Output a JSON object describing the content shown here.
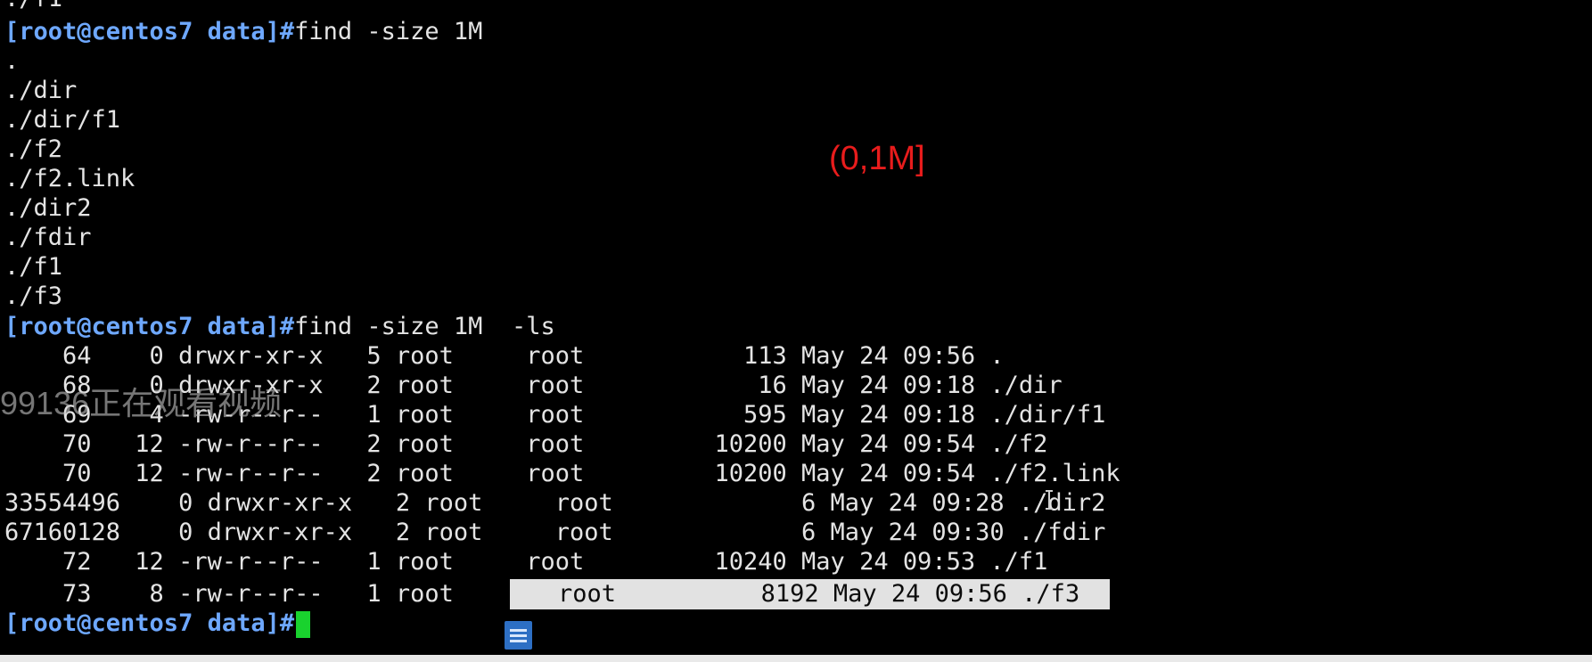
{
  "terminal": {
    "prompt": "[root@centos7 data]#",
    "top_partial": "./f1",
    "cmd1": "find -size 1M",
    "output1": [
      ".",
      "./dir",
      "./dir/f1",
      "./f2",
      "./f2.link",
      "./dir2",
      "./fdir",
      "./f1",
      "./f3"
    ],
    "cmd2": "find -size 1M  -ls",
    "ls_rows": [
      "    64    0 drwxr-xr-x   5 root     root           113 May 24 09:56 .",
      "    68    0 drwxr-xr-x   2 root     root            16 May 24 09:18 ./dir",
      "    69    4 -rw-r--r--   1 root     root           595 May 24 09:18 ./dir/f1",
      "    70   12 -rw-r--r--   2 root     root         10200 May 24 09:54 ./f2",
      "    70   12 -rw-r--r--   2 root     root         10200 May 24 09:54 ./f2.link",
      "33554496    0 drwxr-xr-x   2 root     root             6 May 24 09:28 ./dir2",
      "67160128    0 drwxr-xr-x   2 root     root             6 May 24 09:30 ./fdir",
      "    72   12 -rw-r--r--   1 root     root         10240 May 24 09:53 ./f1"
    ],
    "ls_last_left": "    73    8 -rw-r--r--   1 root     ",
    "ls_last_sel": "root          8192 May 24 09:56 ./f3"
  },
  "annotation": "(0,1M]",
  "watermark": "99136正在观看视频",
  "colors": {
    "prompt": "#6ea8ff",
    "cursor": "#19d22e",
    "annotation": "#e81c1c",
    "highlight": "#e2e2e2"
  }
}
